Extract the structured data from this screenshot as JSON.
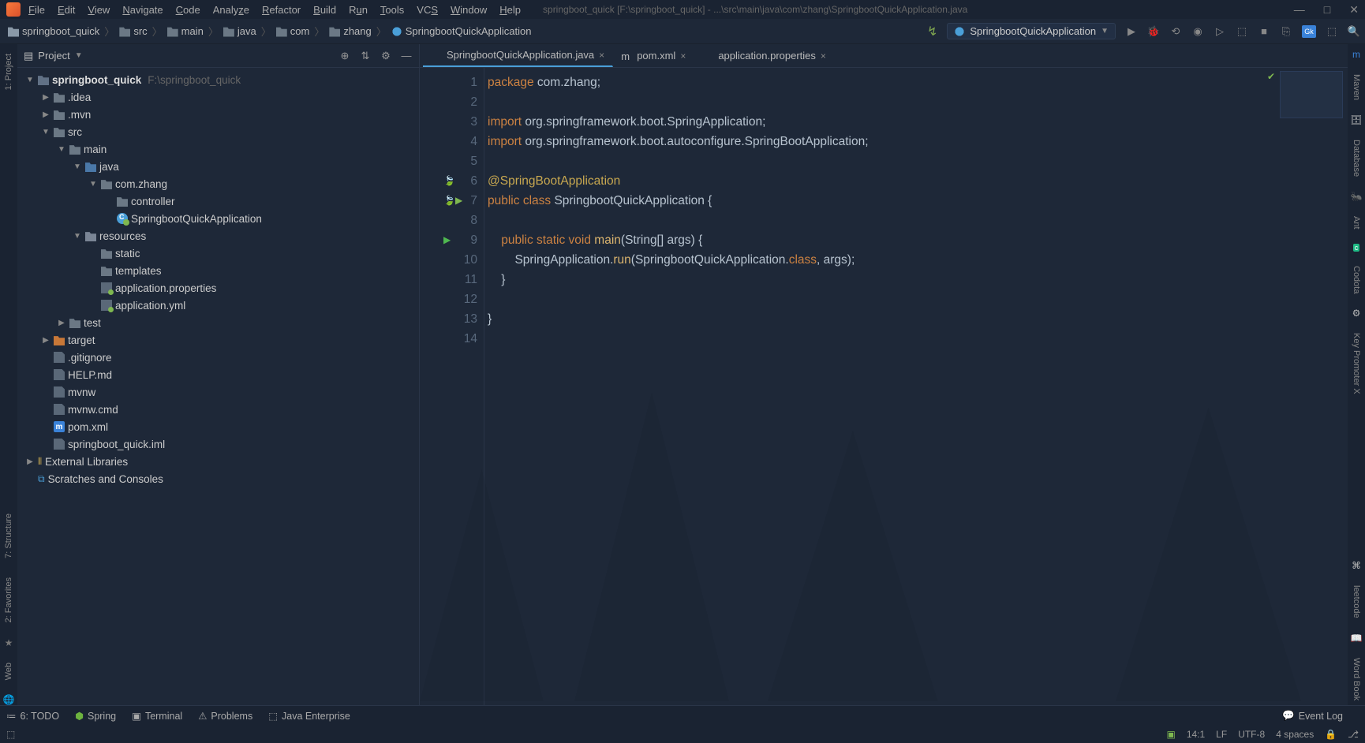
{
  "menubar": {
    "items": [
      "File",
      "Edit",
      "View",
      "Navigate",
      "Code",
      "Analyze",
      "Refactor",
      "Build",
      "Run",
      "Tools",
      "VCS",
      "Window",
      "Help"
    ],
    "title": "springboot_quick [F:\\springboot_quick] - ...\\src\\main\\java\\com\\zhang\\SpringbootQuickApplication.java"
  },
  "breadcrumb": [
    "springboot_quick",
    "src",
    "main",
    "java",
    "com",
    "zhang",
    "SpringbootQuickApplication"
  ],
  "runconfig": "SpringbootQuickApplication",
  "sidebar": {
    "title": "Project",
    "tree": {
      "root": {
        "name": "springboot_quick",
        "hint": "F:\\springboot_quick"
      },
      "idea": ".idea",
      "mvn": ".mvn",
      "src": "src",
      "main": "main",
      "java": "java",
      "pkg": "com.zhang",
      "controller": "controller",
      "app": "SpringbootQuickApplication",
      "resources": "resources",
      "static": "static",
      "templates": "templates",
      "appprops": "application.properties",
      "appyml": "application.yml",
      "test": "test",
      "target": "target",
      "gitignore": ".gitignore",
      "help": "HELP.md",
      "mvnw": "mvnw",
      "mvnwcmd": "mvnw.cmd",
      "pom": "pom.xml",
      "iml": "springboot_quick.iml",
      "extlib": "External Libraries",
      "scratches": "Scratches and Consoles"
    }
  },
  "tabs": [
    {
      "label": "SpringbootQuickApplication.java",
      "active": true,
      "icon": "class"
    },
    {
      "label": "pom.xml",
      "active": false,
      "icon": "m"
    },
    {
      "label": "application.properties",
      "active": false,
      "icon": "prop"
    }
  ],
  "code": {
    "l1": "package com.zhang;",
    "l3": "import org.springframework.boot.SpringApplication;",
    "l4": "import org.springframework.boot.autoconfigure.SpringBootApplication;",
    "l6": "@SpringBootApplication",
    "l7": "public class SpringbootQuickApplication {",
    "l9": "    public static void main(String[] args) {",
    "l10": "        SpringApplication.run(SpringbootQuickApplication.class, args);",
    "l11": "    }",
    "l13": "}"
  },
  "leftstripe": [
    "1: Project",
    "7: Structure",
    "2: Favorites",
    "Web"
  ],
  "rightstripe": [
    "Maven",
    "Database",
    "Ant",
    "Codota",
    "Key Promoter X",
    "leetcode",
    "Word Book"
  ],
  "bottombar": [
    "6: TODO",
    "Spring",
    "Terminal",
    "Problems",
    "Java Enterprise"
  ],
  "eventlog": "Event Log",
  "status": {
    "pos": "14:1",
    "eol": "LF",
    "enc": "UTF-8",
    "indent": "4 spaces"
  }
}
